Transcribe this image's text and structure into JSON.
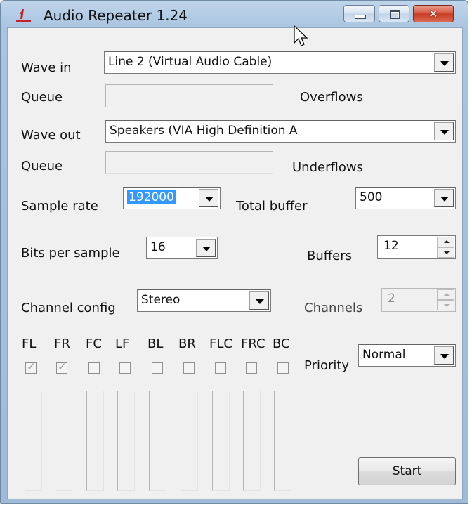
{
  "window": {
    "title": "Audio Repeater 1.24",
    "accent": "#c8202a"
  },
  "titlebar": {
    "minimize_icon": "minimize-icon",
    "maximize_icon": "maximize-icon",
    "close_icon": "close-icon",
    "close_glyph": "✕"
  },
  "wave_in": {
    "label": "Wave in",
    "value": "Line 2 (Virtual Audio Cable)",
    "queue_label": "Queue",
    "overflows_label": "Overflows"
  },
  "wave_out": {
    "label": "Wave out",
    "value": "Speakers (VIA High Definition A",
    "queue_label": "Queue",
    "underflows_label": "Underflows"
  },
  "sample_rate": {
    "label": "Sample rate",
    "value": "192000"
  },
  "total_buffer": {
    "label": "Total buffer",
    "value": "500"
  },
  "bits_per_sample": {
    "label": "Bits per sample",
    "value": "16"
  },
  "buffers": {
    "label": "Buffers",
    "value": "12"
  },
  "channel_config": {
    "label": "Channel config",
    "value": "Stereo"
  },
  "channels": {
    "label": "Channels",
    "value": "2"
  },
  "speakers": [
    {
      "label": "FL",
      "checked": true
    },
    {
      "label": "FR",
      "checked": true
    },
    {
      "label": "FC",
      "checked": false
    },
    {
      "label": "LF",
      "checked": false
    },
    {
      "label": "BL",
      "checked": false
    },
    {
      "label": "BR",
      "checked": false
    },
    {
      "label": "FLC",
      "checked": false
    },
    {
      "label": "FRC",
      "checked": false
    },
    {
      "label": "BC",
      "checked": false
    }
  ],
  "priority": {
    "label": "Priority",
    "value": "Normal"
  },
  "start_button": "Start"
}
